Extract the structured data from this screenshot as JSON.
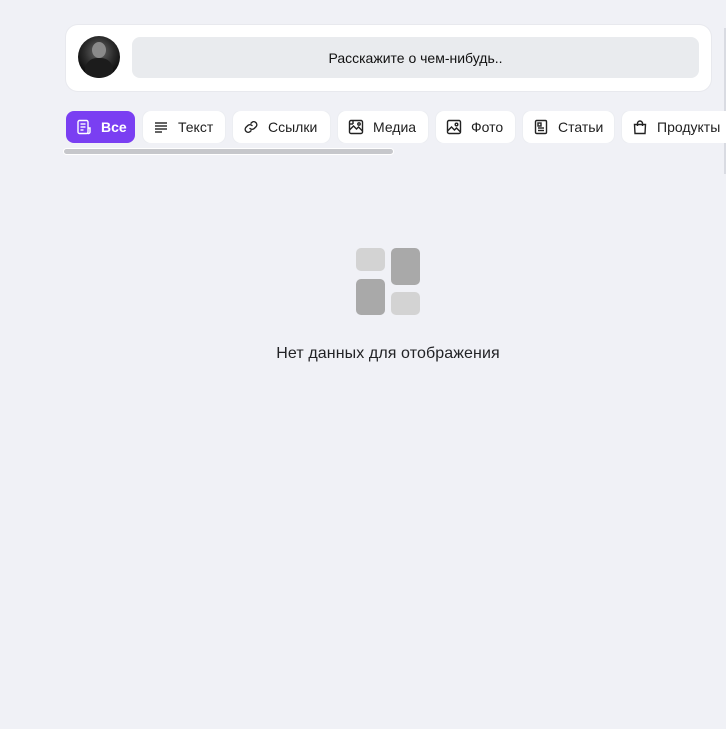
{
  "composer": {
    "placeholder": "Расскажите о чем-нибудь.."
  },
  "tabs": [
    {
      "label": "Все",
      "icon": "feed-icon",
      "active": true
    },
    {
      "label": "Текст",
      "icon": "text-lines-icon",
      "active": false
    },
    {
      "label": "Ссылки",
      "icon": "link-icon",
      "active": false
    },
    {
      "label": "Медиа",
      "icon": "media-icon",
      "active": false
    },
    {
      "label": "Фото",
      "icon": "photo-icon",
      "active": false
    },
    {
      "label": "Статьи",
      "icon": "article-icon",
      "active": false
    },
    {
      "label": "Продукты",
      "icon": "shopping-bag-icon",
      "active": false
    }
  ],
  "empty_state": {
    "message": "Нет данных для отображения",
    "icon": "empty-grid-icon"
  },
  "colors": {
    "accent": "#7a3ff2",
    "background": "#f0f1f6",
    "card": "#ffffff",
    "input_bg": "#e9ebee"
  }
}
